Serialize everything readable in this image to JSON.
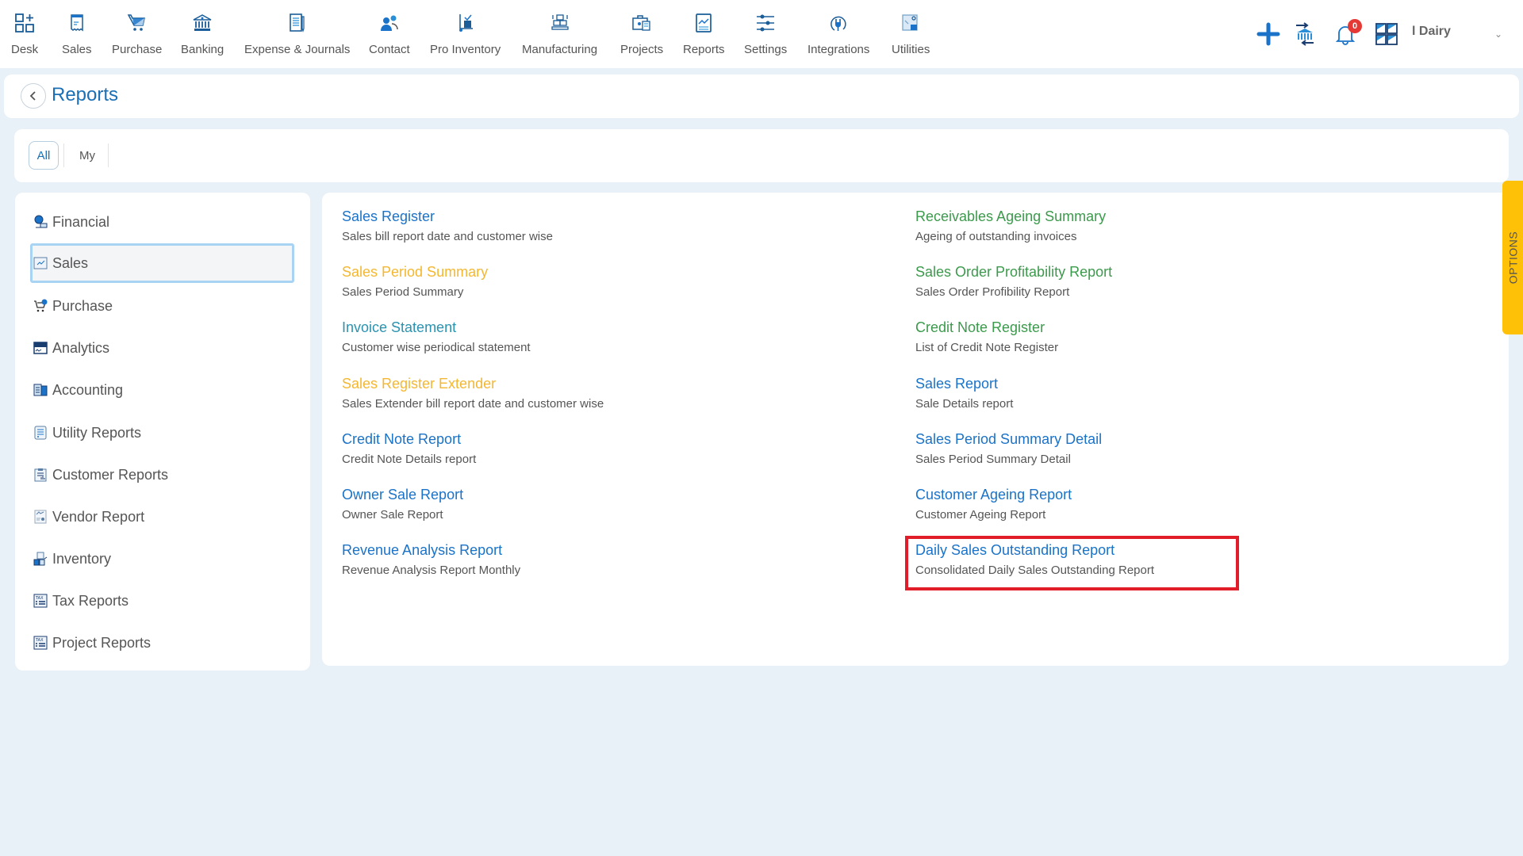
{
  "nav": {
    "items": [
      {
        "label": "Desk",
        "icon": "desk-icon"
      },
      {
        "label": "Sales",
        "icon": "receipt-icon"
      },
      {
        "label": "Purchase",
        "icon": "cart-icon"
      },
      {
        "label": "Banking",
        "icon": "bank-icon"
      },
      {
        "label": "Expense & Journals",
        "icon": "notebook-icon"
      },
      {
        "label": "Contact",
        "icon": "contacts-icon"
      },
      {
        "label": "Pro Inventory",
        "icon": "trolley-icon"
      },
      {
        "label": "Manufacturing",
        "icon": "boxes-icon"
      },
      {
        "label": "Projects",
        "icon": "briefcase-icon"
      },
      {
        "label": "Reports",
        "icon": "report-chart-icon"
      },
      {
        "label": "Settings",
        "icon": "sliders-icon"
      },
      {
        "label": "Integrations",
        "icon": "plug-icon"
      },
      {
        "label": "Utilities",
        "icon": "utilities-icon"
      }
    ],
    "notification_count": "0",
    "company_name": "l Dairy"
  },
  "header": {
    "title": "Reports"
  },
  "tabs": {
    "all": "All",
    "my": "My"
  },
  "sidebar": {
    "items": [
      {
        "label": "Financial"
      },
      {
        "label": "Sales",
        "active": true
      },
      {
        "label": "Purchase"
      },
      {
        "label": "Analytics"
      },
      {
        "label": "Accounting"
      },
      {
        "label": "Utility Reports"
      },
      {
        "label": "Customer Reports"
      },
      {
        "label": "Vendor Report"
      },
      {
        "label": "Inventory"
      },
      {
        "label": "Tax Reports"
      },
      {
        "label": "Project Reports"
      }
    ]
  },
  "reports": {
    "left": [
      {
        "title": "Sales Register",
        "desc": "Sales bill report date and customer wise",
        "color": "#1a73c8"
      },
      {
        "title": "Sales Period Summary",
        "desc": "Sales Period Summary",
        "color": "#f4b731"
      },
      {
        "title": "Invoice Statement",
        "desc": "Customer wise periodical statement",
        "color": "#2a93b0"
      },
      {
        "title": "Sales Register Extender",
        "desc": "Sales Extender bill report date and customer wise",
        "color": "#f4b731"
      },
      {
        "title": "Credit Note Report",
        "desc": "Credit Note Details report",
        "color": "#1a73c8"
      },
      {
        "title": "Owner Sale Report",
        "desc": "Owner Sale Report",
        "color": "#1a73c8"
      },
      {
        "title": "Revenue Analysis Report",
        "desc": "Revenue Analysis Report Monthly",
        "color": "#1a73c8"
      }
    ],
    "right": [
      {
        "title": "Receivables Ageing Summary",
        "desc": "Ageing of outstanding invoices",
        "color": "#3c9a4c"
      },
      {
        "title": "Sales Order Profitability Report",
        "desc": "Sales Order Profibility Report",
        "color": "#3c9a4c"
      },
      {
        "title": "Credit Note Register",
        "desc": "List of Credit Note Register",
        "color": "#3c9a4c"
      },
      {
        "title": "Sales Report",
        "desc": "Sale Details report",
        "color": "#1a73c8"
      },
      {
        "title": "Sales Period Summary Detail",
        "desc": "Sales Period Summary Detail",
        "color": "#1a73c8"
      },
      {
        "title": "Customer Ageing Report",
        "desc": "Customer Ageing Report",
        "color": "#1a73c8"
      },
      {
        "title": "Daily Sales Outstanding Report",
        "desc": "Consolidated Daily Sales Outstanding Report",
        "color": "#1a73c8",
        "highlighted": true
      }
    ]
  },
  "options_tab": "OPTIONS",
  "colors": {
    "primary": "#1a6fb5",
    "highlight_box": "#e11d2a",
    "options_tab": "#ffc107",
    "badge": "#e53935"
  }
}
